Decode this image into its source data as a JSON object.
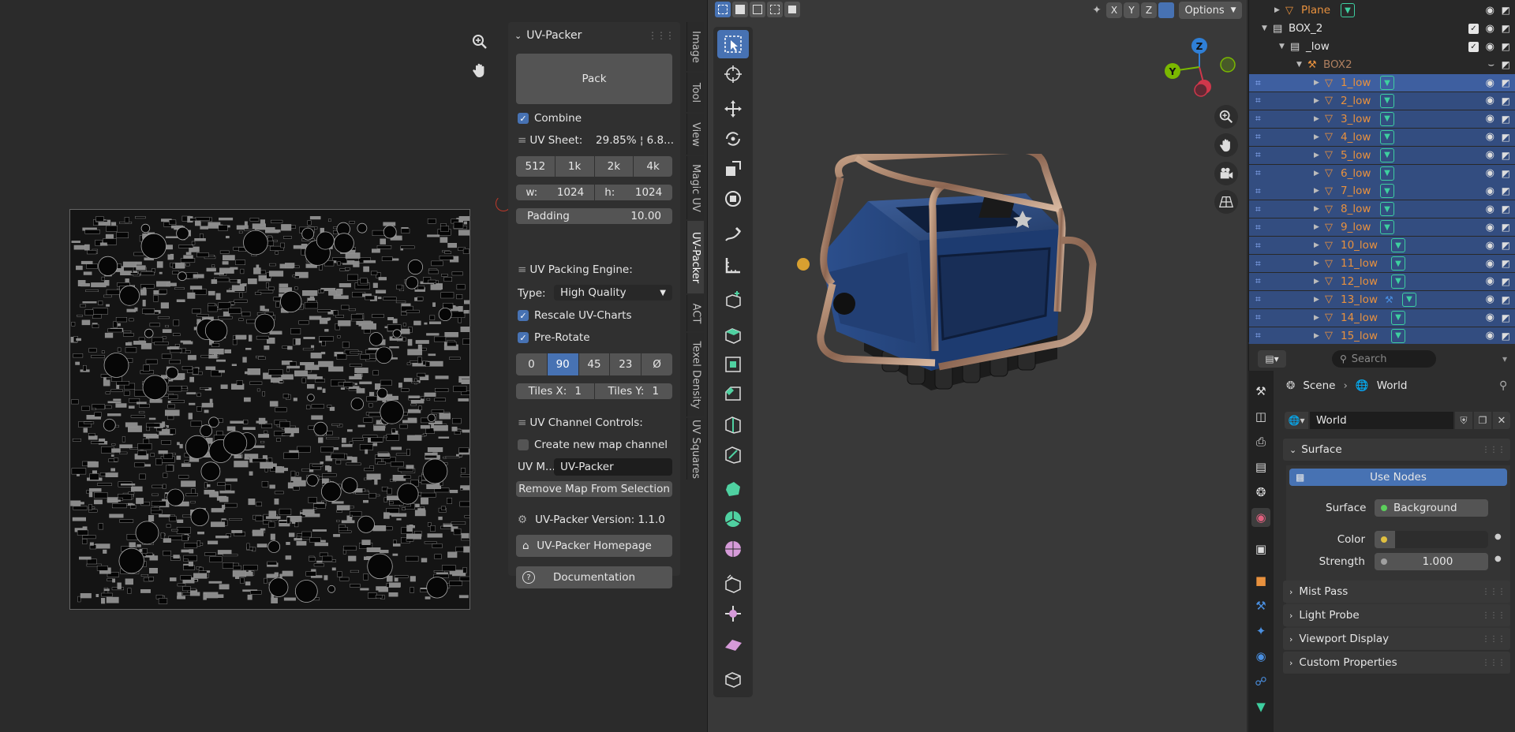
{
  "uv_packer": {
    "title": "UV-Packer",
    "pack_label": "Pack",
    "combine_label": "Combine",
    "uv_sheet_label": "UV Sheet:",
    "uv_sheet_value": "29.85% ¦ 6.8...",
    "sizes": [
      "512",
      "1k",
      "2k",
      "4k"
    ],
    "w_label": "w:",
    "w_value": "1024",
    "h_label": "h:",
    "h_value": "1024",
    "padding_label": "Padding",
    "padding_value": "10.00",
    "engine_label": "UV Packing Engine:",
    "type_label": "Type:",
    "type_value": "High Quality",
    "rescale_label": "Rescale UV-Charts",
    "prerotate_label": "Pre-Rotate",
    "rotations": [
      "0",
      "90",
      "45",
      "23",
      "Ø"
    ],
    "tiles_x_label": "Tiles X:",
    "tiles_x_value": "1",
    "tiles_y_label": "Tiles Y:",
    "tiles_y_value": "1",
    "channel_label": "UV Channel Controls:",
    "create_map_label": "Create new map channel",
    "uv_map_label": "UV M...",
    "uv_map_value": "UV-Packer",
    "remove_map_label": "Remove Map From Selection",
    "version_label": "UV-Packer Version: 1.1.0",
    "homepage_label": "UV-Packer Homepage",
    "docs_label": "Documentation"
  },
  "vtabs": [
    "Image",
    "Tool",
    "View",
    "Magic UV",
    "UV-Packer",
    "ACT",
    "Texel Density",
    "UV Squares"
  ],
  "viewport": {
    "header_axes": [
      "X",
      "Y",
      "Z"
    ],
    "options_label": "Options",
    "gizmo": {
      "z": "Z",
      "y": "Y"
    }
  },
  "outliner": {
    "rows": [
      {
        "name": "Plane"
      },
      {
        "name": "BOX_2"
      },
      {
        "name": "_low"
      },
      {
        "name": "BOX2"
      },
      {
        "name": "1_low"
      },
      {
        "name": "2_low"
      },
      {
        "name": "3_low"
      },
      {
        "name": "4_low"
      },
      {
        "name": "5_low"
      },
      {
        "name": "6_low"
      },
      {
        "name": "7_low"
      },
      {
        "name": "8_low"
      },
      {
        "name": "9_low"
      },
      {
        "name": "10_low"
      },
      {
        "name": "11_low"
      },
      {
        "name": "12_low"
      },
      {
        "name": "13_low"
      },
      {
        "name": "14_low"
      },
      {
        "name": "15_low"
      }
    ]
  },
  "properties": {
    "search_placeholder": "Search",
    "breadcrumb_scene": "Scene",
    "breadcrumb_world": "World",
    "world_name": "World",
    "surface_section": "Surface",
    "use_nodes_label": "Use Nodes",
    "surface_label": "Surface",
    "surface_value": "Background",
    "color_label": "Color",
    "strength_label": "Strength",
    "strength_value": "1.000",
    "sections": [
      "Mist Pass",
      "Light Probe",
      "Viewport Display",
      "Custom Properties"
    ]
  },
  "colors": {
    "accent": "#4772b3",
    "selected_row": "#334d80",
    "object_name": "#e8913e"
  }
}
